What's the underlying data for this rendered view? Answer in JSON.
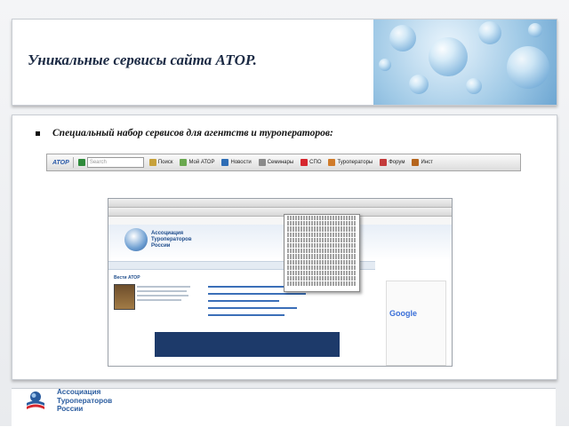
{
  "slide": {
    "title": "Уникальные сервисы сайта АТОР.",
    "bullet": "Специальный набор сервисов для агентств и туроператоров:"
  },
  "toolbar": {
    "logo": "ATOP",
    "search_placeholder": "Search",
    "items": [
      "Поиск",
      "Мой АТОР",
      "Новости",
      "Семинары",
      "СПО",
      "Туроператоры",
      "Форум",
      "Инст"
    ]
  },
  "screenshot": {
    "org_name": [
      "Ассоциация",
      "Туроператоров",
      "России"
    ],
    "news_title": "Вести АТОР",
    "google": "Google"
  },
  "footer": {
    "org_name": [
      "Ассоциация",
      "Туроператоров",
      "России"
    ]
  },
  "colors": {
    "title": "#1b2a44",
    "brand_blue": "#2a5c9f",
    "flag_red": "#d6262e"
  }
}
